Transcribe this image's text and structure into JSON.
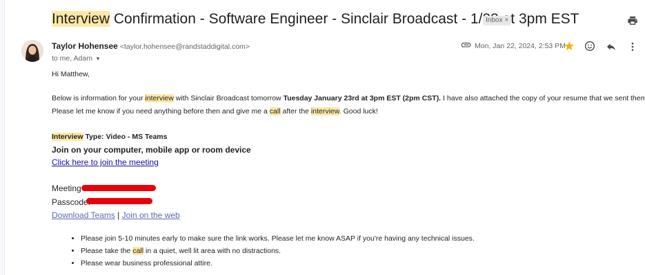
{
  "subject": {
    "highlight": "Interview",
    "rest": " Confirmation - Software Engineer - Sinclair Broadcast - 1/23 at 3pm EST"
  },
  "label_badge": {
    "text": "Inbox",
    "close": "×"
  },
  "icons": {
    "print": "print-icon",
    "attachment": "attachment-icon",
    "star": "star-icon",
    "emoji": "emoji-icon",
    "reply": "reply-icon",
    "more": "more-vert-icon",
    "caret": "caret-down-icon"
  },
  "colors": {
    "highlight": "#fce8a6",
    "star": "#f5b400",
    "redact": "#e8000b",
    "link": "#1a0dab"
  },
  "sender": {
    "name": "Taylor Hohensee",
    "email": "<taylor.hohensee@randstaddigital.com>",
    "to": "to me, Adam",
    "date": "Mon, Jan 22, 2024, 2:53 PM"
  },
  "body": {
    "greeting": "Hi Matthew,",
    "p1": {
      "a": "Below is information for your ",
      "b": "interview",
      "c": " with Sinclair Broadcast tomorrow ",
      "d": "Tuesday January 23rd at 3pm EST (2pm CST).",
      "e": " I have also attached the copy of your resume that we sent them."
    },
    "p2": {
      "a": "Please let me know if you need anything before then and give me a ",
      "b": "call",
      "c": " after the ",
      "d": "interview",
      "e": ". Good luck!"
    },
    "type_line": {
      "highlight": "Interview",
      "rest": " Type: Video - MS Teams"
    },
    "join_heading": "Join on your computer, mobile app or room device",
    "join_link": "Click here to join the meeting",
    "meeting_id_label": "Meeting ID: ",
    "passcode_label": "Passcode: ",
    "download_teams": "Download Teams",
    "separator": " | ",
    "join_web": "Join on the web",
    "bullets": {
      "b1": "Please join 5-10 minutes early to make sure the link works. Please let me know ASAP if you're having any technical issues.",
      "b2a": "Please take the ",
      "b2b": "call",
      "b2c": " in a quiet, well lit area with no distractions.",
      "b3": "Please wear business professional attire."
    }
  }
}
